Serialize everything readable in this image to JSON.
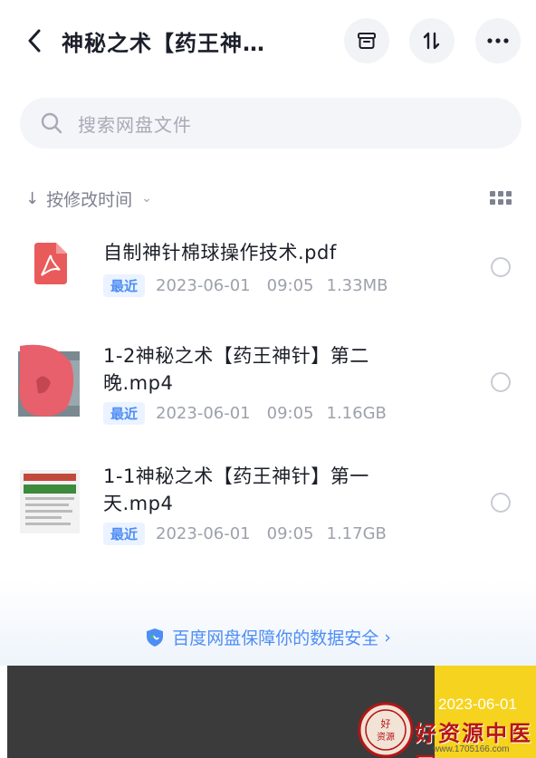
{
  "header": {
    "title": "神秘之术【药王神…"
  },
  "search": {
    "placeholder": "搜索网盘文件"
  },
  "sort": {
    "label": "按修改时间"
  },
  "files": [
    {
      "name": "自制神针棉球操作技术.pdf",
      "badge": "最近",
      "date": "2023-06-01",
      "time": "09:05",
      "size": "1.33MB",
      "icon": "pdf-icon"
    },
    {
      "name": "1-2神秘之术【药王神针】第二晚.mp4",
      "badge": "最近",
      "date": "2023-06-01",
      "time": "09:05",
      "size": "1.16GB",
      "icon": "video-thumbnail"
    },
    {
      "name": "1-1神秘之术【药王神针】第一天.mp4",
      "badge": "最近",
      "date": "2023-06-01",
      "time": "09:05",
      "size": "1.17GB",
      "icon": "video-thumbnail"
    }
  ],
  "footer": {
    "security_text": "百度网盘保障你的数据安全"
  },
  "watermark": {
    "date": "2023-06-01",
    "site_name": "好资源中医网",
    "url": "www.1705166.com",
    "seal_text": "好资源"
  },
  "colors": {
    "accent": "#4e8df5",
    "pdf_red": "#e95b5b",
    "watermark_red": "#b51616",
    "watermark_yellow": "#f6d31e"
  }
}
